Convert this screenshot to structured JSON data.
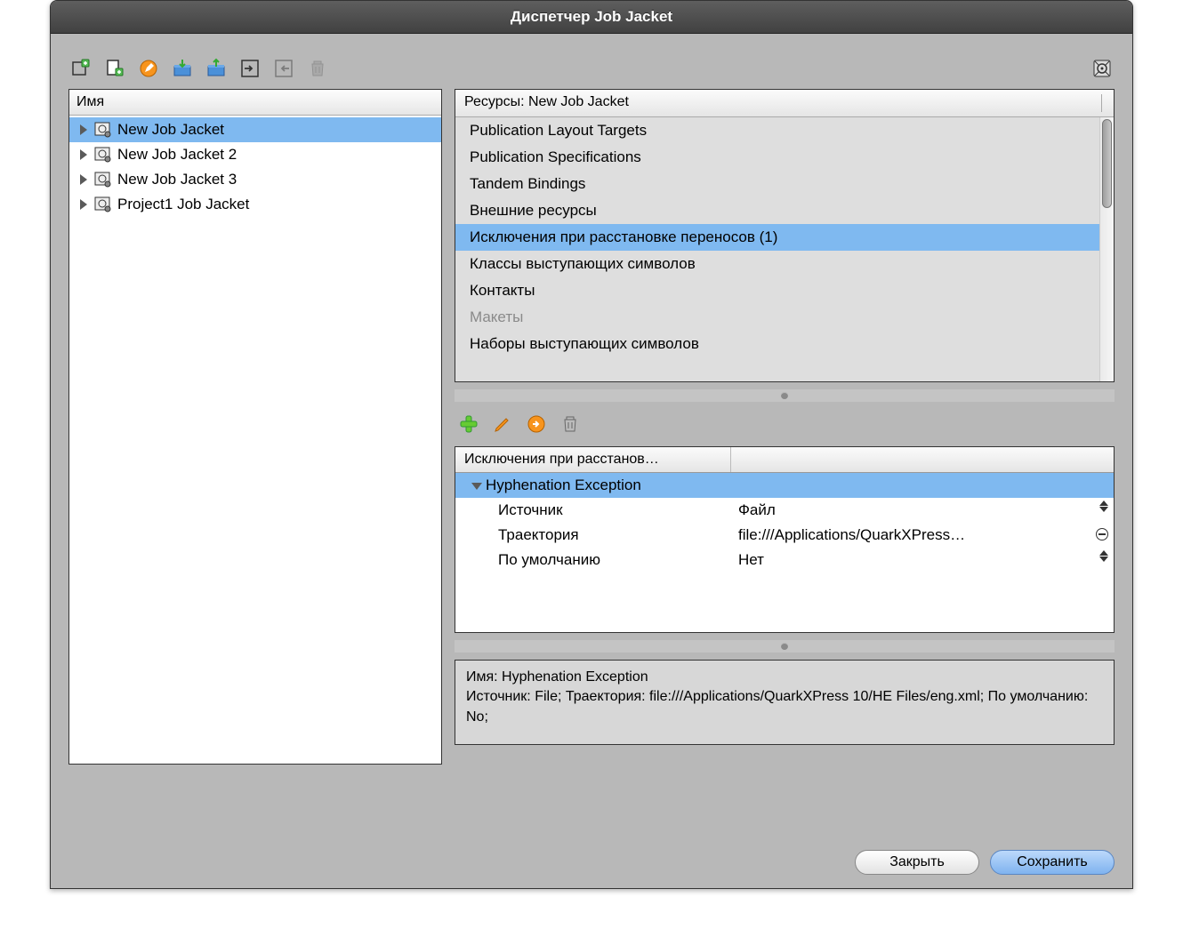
{
  "window": {
    "title": "Диспетчер Job Jacket"
  },
  "left": {
    "header": "Имя",
    "items": [
      {
        "label": "New Job Jacket",
        "selected": true
      },
      {
        "label": "New Job Jacket 2",
        "selected": false
      },
      {
        "label": "New Job Jacket 3",
        "selected": false
      },
      {
        "label": "Project1 Job Jacket",
        "selected": false
      }
    ]
  },
  "resources": {
    "header": "Ресурсы: New Job Jacket",
    "items": [
      {
        "label": "Publication Layout Targets"
      },
      {
        "label": "Publication Specifications"
      },
      {
        "label": "Tandem Bindings"
      },
      {
        "label": "Внешние ресурсы"
      },
      {
        "label": "Исключения при расстановке переносов (1)",
        "selected": true
      },
      {
        "label": "Классы выступающих символов"
      },
      {
        "label": "Контакты"
      },
      {
        "label": "Макеты",
        "dim": true
      },
      {
        "label": "Наборы выступающих символов"
      }
    ]
  },
  "detail": {
    "header": "Исключения при расстанов…",
    "rootLabel": "Hyphenation Exception",
    "rows": [
      {
        "k": "Источник",
        "v": "Файл",
        "control": "stepper"
      },
      {
        "k": "Траектория",
        "v": "file:///Applications/QuarkXPress…",
        "control": "minus"
      },
      {
        "k": "По умолчанию",
        "v": "Нет",
        "control": "stepper"
      }
    ]
  },
  "info": {
    "line1": "Имя: Hyphenation Exception",
    "line2": "Источник: File; Траектория: file:///Applications/QuarkXPress 10/HE Files/eng.xml; По умолчанию: No;"
  },
  "footer": {
    "close": "Закрыть",
    "save": "Сохранить"
  },
  "icons": {
    "new_jacket": "new-jacket-icon",
    "new_ticket": "new-ticket-icon",
    "edit": "edit-icon",
    "import": "import-icon",
    "export": "export-icon",
    "link": "link-icon",
    "unlink": "unlink-icon",
    "trash": "trash-icon",
    "settings": "settings-icon",
    "add": "add-icon",
    "pencil": "pencil-icon",
    "apply": "apply-icon",
    "trash2": "trash2-icon"
  }
}
